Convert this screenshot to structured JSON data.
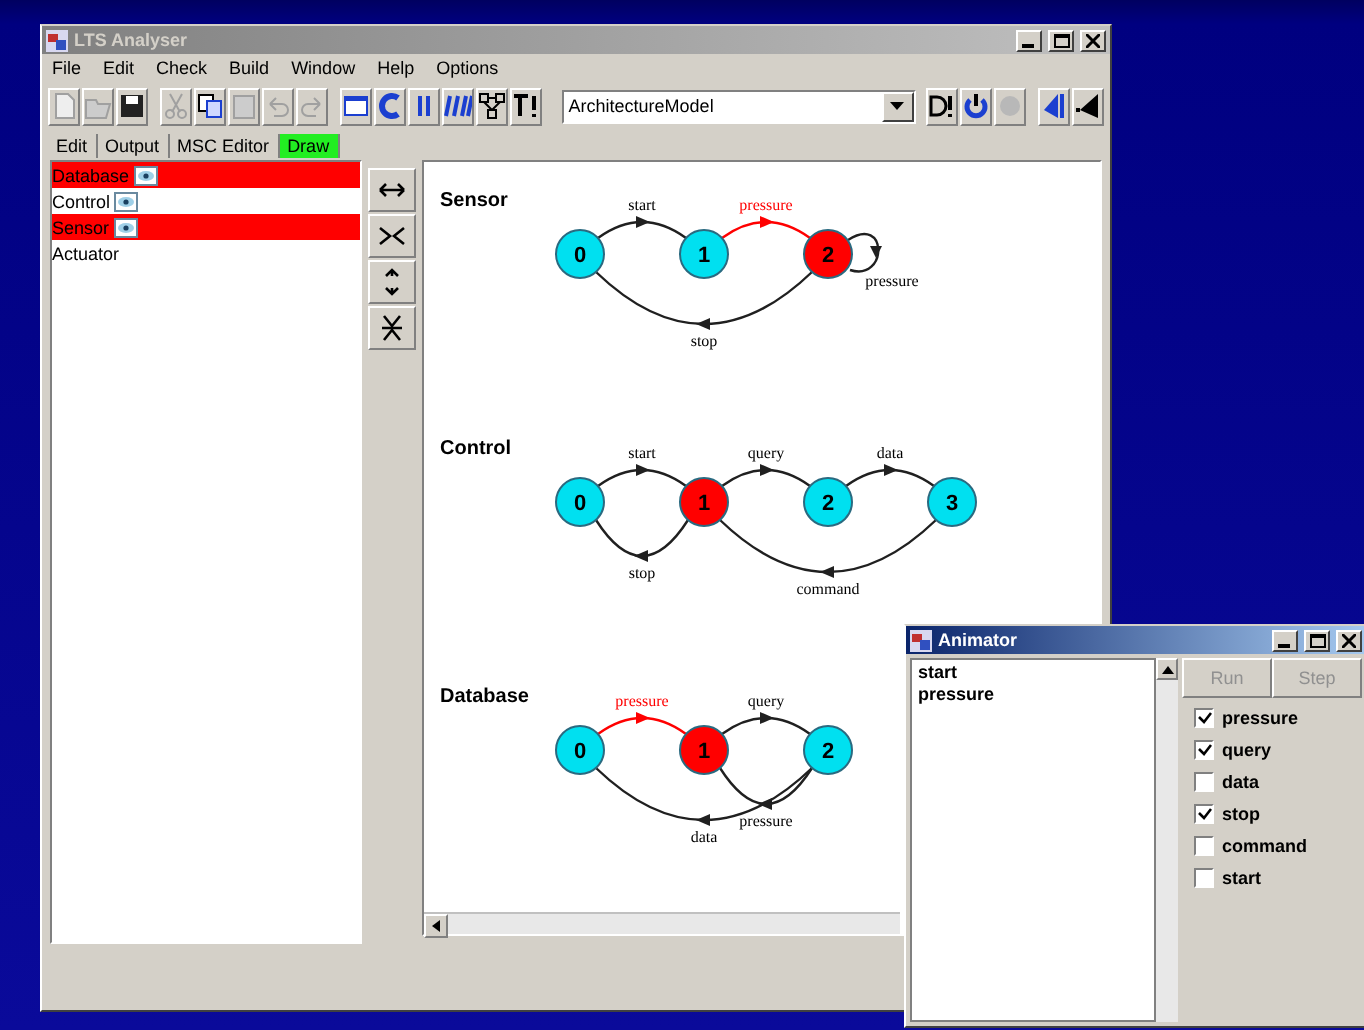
{
  "main_window": {
    "title": "LTS Analyser",
    "active": false,
    "menu": [
      "File",
      "Edit",
      "Check",
      "Build",
      "Window",
      "Help",
      "Options"
    ],
    "toolbar": [
      {
        "kind": "new",
        "disabled": true
      },
      {
        "kind": "open",
        "disabled": true
      },
      {
        "kind": "save",
        "disabled": false
      },
      {
        "kind": "cut",
        "disabled": true
      },
      {
        "kind": "copy",
        "disabled": false
      },
      {
        "kind": "paste",
        "disabled": true
      },
      {
        "kind": "undo",
        "disabled": true
      },
      {
        "kind": "redo",
        "disabled": true
      },
      {
        "kind": "window",
        "disabled": false
      },
      {
        "kind": "compile",
        "disabled": false
      },
      {
        "kind": "parallel",
        "disabled": false
      },
      {
        "kind": "minimise",
        "disabled": false
      },
      {
        "kind": "network",
        "disabled": false
      },
      {
        "kind": "check",
        "disabled": false
      }
    ],
    "target": "ArchitectureModel",
    "toolbar_right": [
      {
        "kind": "safety",
        "disabled": false
      },
      {
        "kind": "progress",
        "disabled": false
      },
      {
        "kind": "stop",
        "disabled": true
      },
      {
        "kind": "forward",
        "disabled": false
      },
      {
        "kind": "back",
        "disabled": false
      }
    ],
    "tabs": [
      {
        "label": "Edit",
        "selected": false
      },
      {
        "label": "Output",
        "selected": false
      },
      {
        "label": "MSC Editor",
        "selected": false
      },
      {
        "label": "Draw",
        "selected": true
      }
    ],
    "processes": [
      {
        "name": "Database",
        "selected": true,
        "icon": true
      },
      {
        "name": "Control",
        "selected": false,
        "icon": true
      },
      {
        "name": "Sensor",
        "selected": true,
        "icon": true
      },
      {
        "name": "Actuator",
        "selected": false,
        "icon": false
      }
    ],
    "view_tools": [
      {
        "kind": "widen"
      },
      {
        "kind": "narrow"
      },
      {
        "kind": "stretch"
      },
      {
        "kind": "squash"
      }
    ],
    "machines": [
      {
        "name": "Sensor",
        "states": [
          {
            "label": "0",
            "current": false,
            "transitions": [
              {
                "label": "start",
                "kind": "next",
                "enabled": false
              }
            ]
          },
          {
            "label": "1",
            "current": false,
            "transitions": [
              {
                "label": "pressure",
                "kind": "next",
                "enabled": true
              }
            ]
          },
          {
            "label": "2",
            "current": true,
            "transitions": [
              {
                "label": "pressure",
                "kind": "loop",
                "enabled": false
              },
              {
                "label": "stop",
                "kind": "return",
                "enabled": false
              }
            ]
          }
        ]
      },
      {
        "name": "Control",
        "states": [
          {
            "label": "0",
            "current": false,
            "transitions": [
              {
                "label": "start",
                "kind": "next",
                "enabled": false
              }
            ]
          },
          {
            "label": "1",
            "current": true,
            "transitions": [
              {
                "label": "query",
                "kind": "next",
                "enabled": false
              },
              {
                "label": "stop",
                "kind": "back",
                "enabled": false
              }
            ]
          },
          {
            "label": "2",
            "current": false,
            "transitions": [
              {
                "label": "data",
                "kind": "next",
                "enabled": false
              }
            ]
          },
          {
            "label": "3",
            "current": false,
            "transitions": [
              {
                "label": "command",
                "kind": "return",
                "enabled": false
              }
            ]
          }
        ]
      },
      {
        "name": "Database",
        "states": [
          {
            "label": "0",
            "current": false,
            "transitions": [
              {
                "label": "pressure",
                "kind": "next",
                "enabled": true
              }
            ]
          },
          {
            "label": "1",
            "current": true,
            "transitions": [
              {
                "label": "query",
                "kind": "next",
                "enabled": false
              }
            ]
          },
          {
            "label": "2",
            "current": false,
            "transitions": [
              {
                "label": "pressure",
                "kind": "back",
                "enabled": false
              },
              {
                "label": "data",
                "kind": "return",
                "enabled": false
              }
            ]
          }
        ]
      }
    ]
  },
  "animator": {
    "title": "Animator",
    "active": true,
    "trace": [
      "start",
      "pressure"
    ],
    "buttons": [
      {
        "label": "Run",
        "disabled": true
      },
      {
        "label": "Step",
        "disabled": true
      }
    ],
    "actions": [
      {
        "label": "pressure",
        "checked": true
      },
      {
        "label": "query",
        "checked": true
      },
      {
        "label": "data",
        "checked": false
      },
      {
        "label": "stop",
        "checked": true
      },
      {
        "label": "command",
        "checked": false
      },
      {
        "label": "start",
        "checked": false
      }
    ]
  }
}
